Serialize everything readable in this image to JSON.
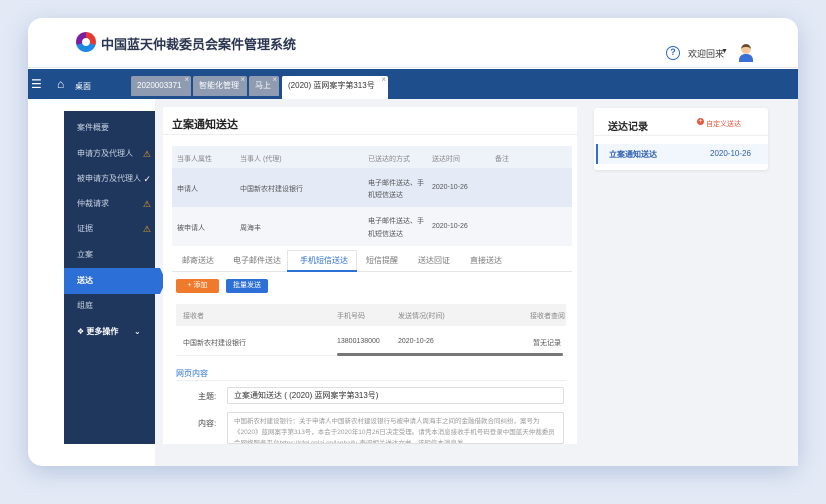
{
  "app": {
    "title": "中国蓝天仲裁委员会案件管理系统",
    "welcome": "欢迎回来"
  },
  "tabbar": {
    "home": "桌面",
    "tabs": [
      {
        "label": "2020003371"
      },
      {
        "label": "智能化管理"
      },
      {
        "label": "马上"
      },
      {
        "label": "(2020) 蓝网案字第313号"
      }
    ]
  },
  "sidebar": {
    "items": [
      {
        "label": "案件概要"
      },
      {
        "label": "申请方及代理人"
      },
      {
        "label": "被申请方及代理人"
      },
      {
        "label": "仲裁请求"
      },
      {
        "label": "证据"
      },
      {
        "label": "立案"
      },
      {
        "label": "送达"
      },
      {
        "label": "组庭"
      }
    ],
    "more": "更多操作"
  },
  "main": {
    "title": "立案通知送达",
    "record_table": {
      "headers": [
        "当事人属性",
        "当事人 (代理)",
        "已送达的方式",
        "送达时间",
        "备注"
      ],
      "rows": [
        {
          "attr": "申请人",
          "party": "中国新农村建设银行",
          "method1": "电子邮件送达、手",
          "method2": "机短信送达",
          "time": "2020-10-26"
        },
        {
          "attr": "被申请人",
          "party": "周海丰",
          "method1": "电子邮件送达、手",
          "method2": "机短信送达",
          "time": "2020-10-26"
        }
      ]
    },
    "subtabs": [
      "邮寄送达",
      "电子邮件送达",
      "手机短信送达",
      "短信提醒",
      "送达回证",
      "直接送达"
    ],
    "buttons": {
      "add": "+ 添加",
      "batch": "批量发送"
    },
    "sms_table": {
      "headers": [
        "接收者",
        "手机号码",
        "发送情况(时间)",
        "接收者查阅"
      ],
      "row": {
        "receiver": "中国新农村建设银行",
        "phone": "13800138000",
        "time": "2020-10-26",
        "status": "暂无记录"
      }
    },
    "web_section": "网页内容",
    "form": {
      "subject_label": "主题:",
      "subject": "立案通知送达 ( (2020) 蓝网案字第313号)",
      "content_label": "内容:",
      "content": "中国新农村建设银行：关于申请人中国新农村建设银行与被申请人周海丰之间的金融借款合同纠纷，案号为《2020》蓝网案字第313号，本会于2020年10月26日决定受理。请凭本消息接收手机号码登录中国蓝天仲裁委员会网络服务平台https://sfgl.cnlai.cn/lanhaifu 查阅相关送达文书，该短信本消息发"
    }
  },
  "right_panel": {
    "title": "送达记录",
    "custom": "自定义送达",
    "item": {
      "name": "立案通知送达",
      "date": "2020-10-26"
    }
  }
}
